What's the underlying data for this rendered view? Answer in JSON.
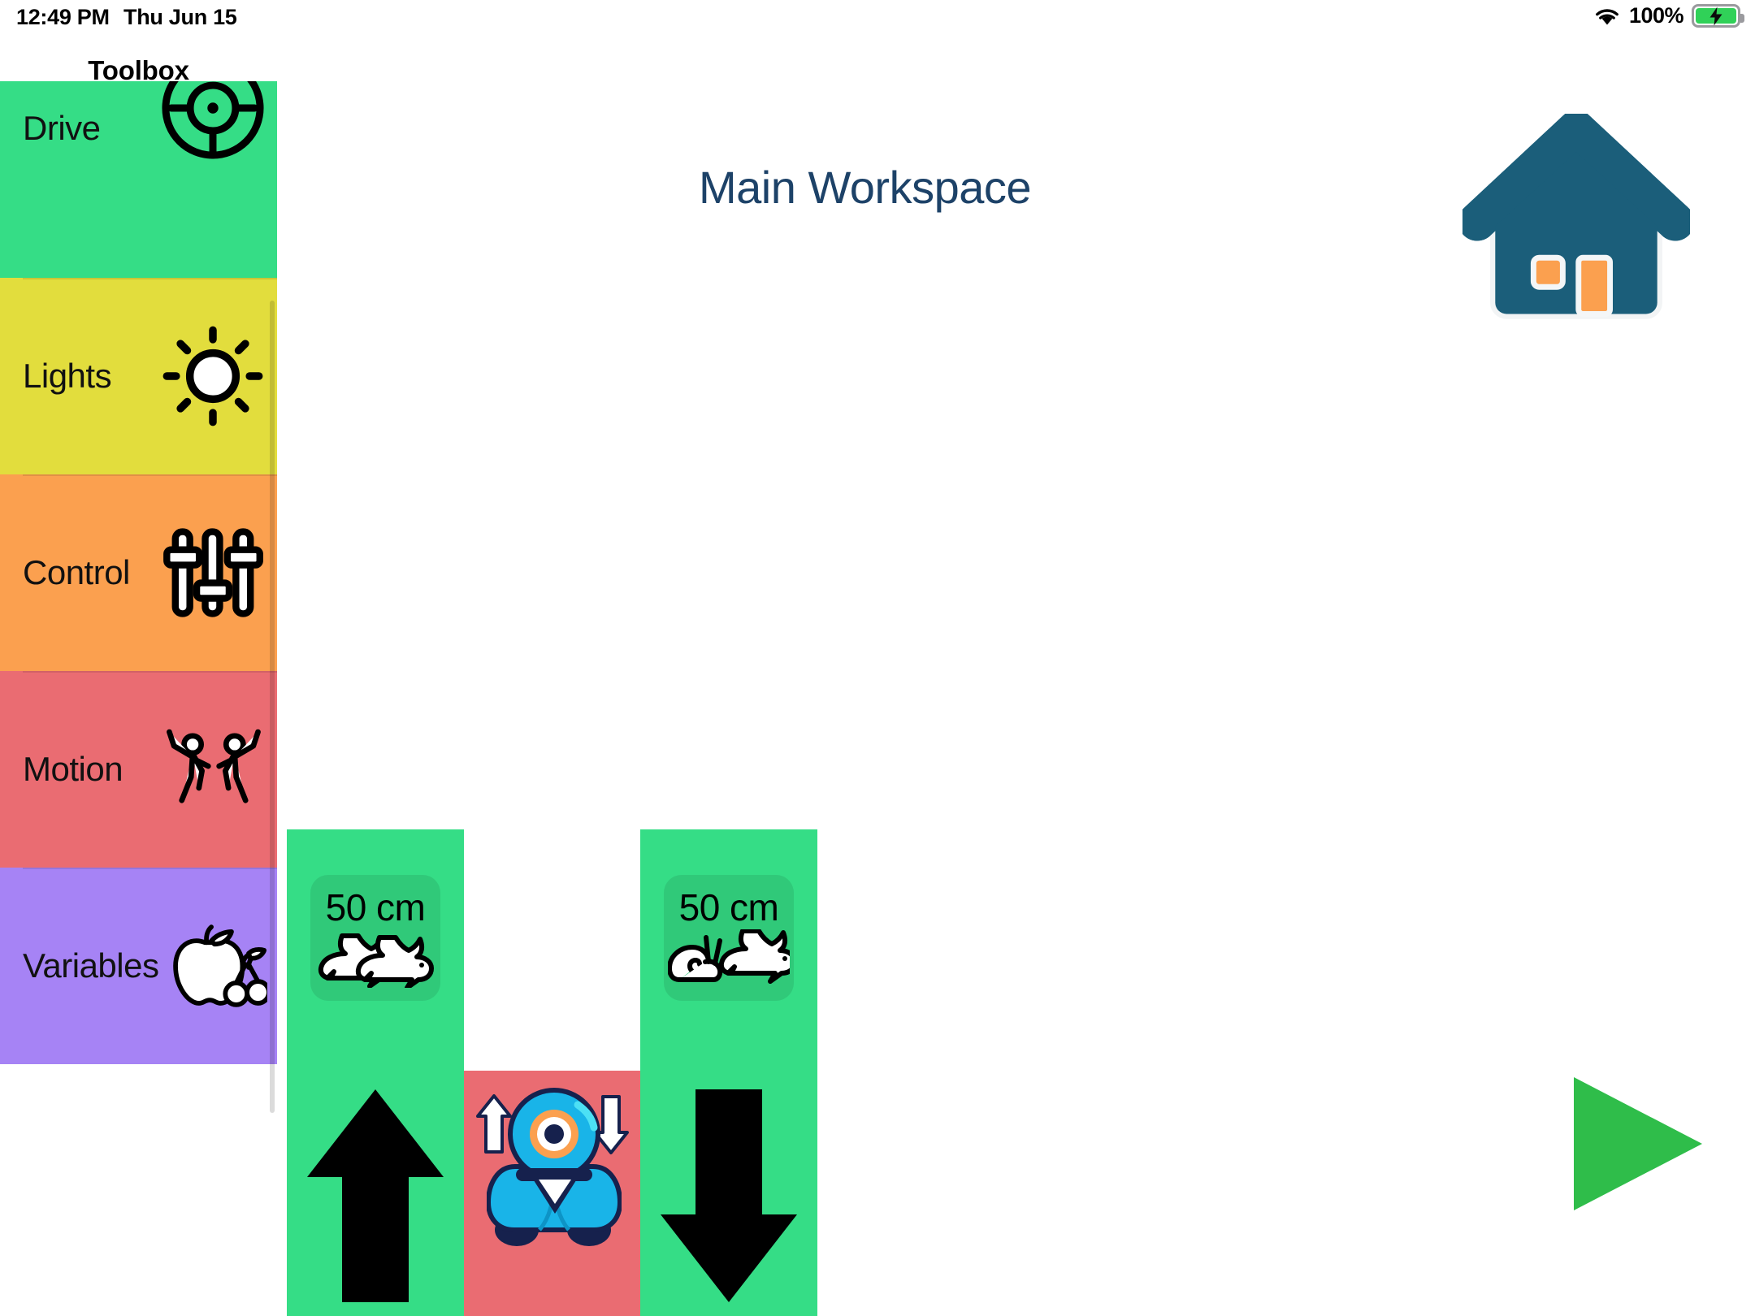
{
  "status_bar": {
    "time": "12:49 PM",
    "date": "Thu Jun 15",
    "battery_percent": "100%",
    "wifi_icon": "wifi-icon",
    "battery_icon": "battery-charging-icon"
  },
  "toolbox": {
    "title": "Toolbox",
    "categories": [
      {
        "label": "Drive",
        "color": "#35dd86",
        "icon": "steering-wheel-icon"
      },
      {
        "label": "Lights",
        "color": "#e2dd3d",
        "icon": "sun-icon"
      },
      {
        "label": "Control",
        "color": "#fba04f",
        "icon": "sliders-icon"
      },
      {
        "label": "Motion",
        "color": "#ea6c72",
        "icon": "dancing-people-icon"
      },
      {
        "label": "Variables",
        "color": "#a683f5",
        "icon": "apple-cherries-icon"
      }
    ]
  },
  "workspace": {
    "title": "Main Workspace",
    "home_button_label": "home-icon",
    "play_button_label": "play-icon",
    "accent_color": "#1d4268",
    "play_color": "#2fbd4a",
    "blocks": [
      {
        "name": "drive-forward-block",
        "color": "#35dd86",
        "param_value": "50 cm",
        "param_icon": "two-rabbits-icon",
        "direction_icon": "arrow-up-icon"
      },
      {
        "name": "robot-block",
        "color": "#ea6c72",
        "robot_icon": "dash-robot-icon",
        "left_icon": "arrow-up-icon",
        "right_icon": "arrow-down-icon"
      },
      {
        "name": "drive-backward-block",
        "color": "#35dd86",
        "param_value": "50 cm",
        "param_icon": "snail-rabbit-icon",
        "direction_icon": "arrow-down-icon"
      }
    ]
  }
}
